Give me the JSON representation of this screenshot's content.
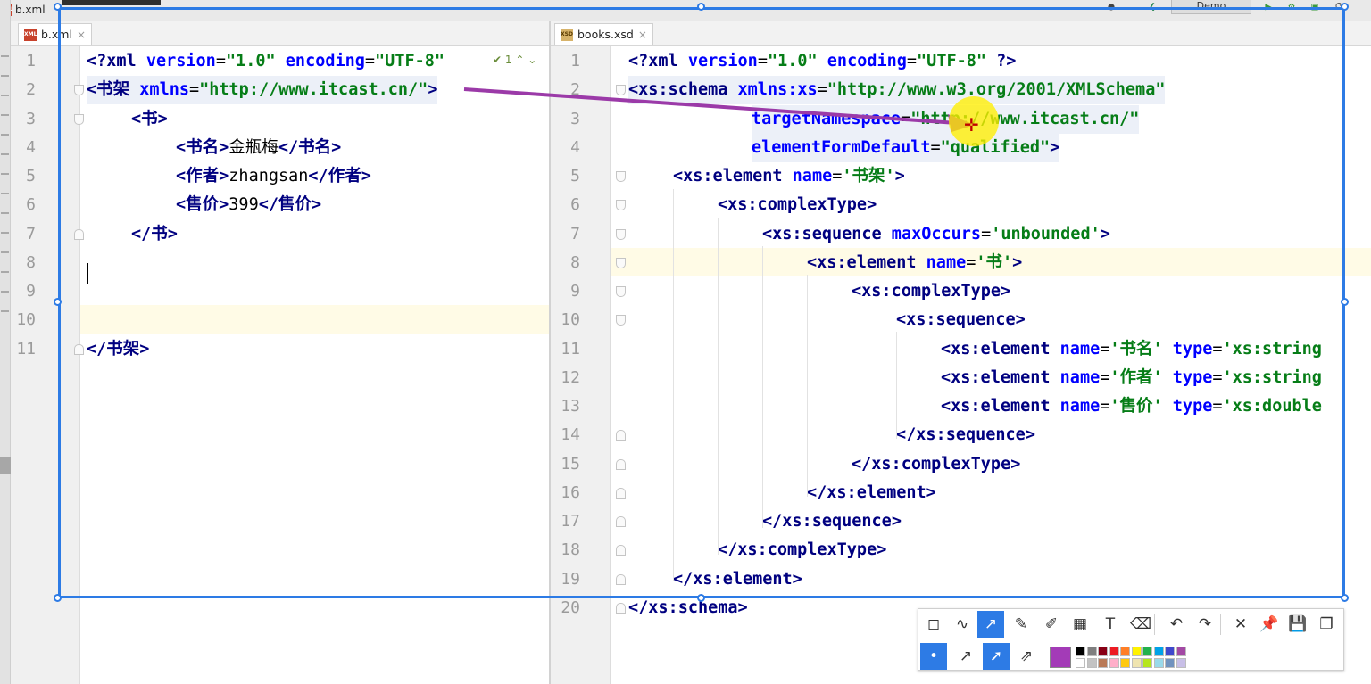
{
  "window": {
    "title_file": "b.xml",
    "run_config": "Demo"
  },
  "tabs": {
    "left": {
      "label": "b.xml",
      "close": "×"
    },
    "right": {
      "label": "books.xsd",
      "close": "×"
    }
  },
  "left_editor": {
    "hint": "✔ 1  ⌃  ⌄",
    "line_numbers": [
      "1",
      "2",
      "3",
      "4",
      "5",
      "6",
      "7",
      "8",
      "9",
      "10",
      "11"
    ],
    "lines": [
      [
        "<?",
        "xml",
        " version",
        "=",
        "\"1.0\"",
        " encoding",
        "=",
        "\"UTF-8\""
      ],
      [
        "<",
        "书架",
        " xmlns",
        "=",
        "\"http://www.itcast.cn/\"",
        ">"
      ],
      [
        "<",
        "书",
        ">"
      ],
      [
        "<",
        "书名",
        ">",
        "金瓶梅",
        "</",
        "书名",
        ">"
      ],
      [
        "<",
        "作者",
        ">",
        "zhangsan",
        "</",
        "作者",
        ">"
      ],
      [
        "<",
        "售价",
        ">",
        "399",
        "</",
        "售价",
        ">"
      ],
      [
        "</",
        "书",
        ">"
      ],
      [],
      [],
      [],
      [
        "</",
        "书架",
        ">"
      ]
    ]
  },
  "right_editor": {
    "line_numbers": [
      "1",
      "2",
      "3",
      "4",
      "5",
      "6",
      "7",
      "8",
      "9",
      "10",
      "11",
      "12",
      "13",
      "14",
      "15",
      "16",
      "17",
      "18",
      "19",
      "20"
    ],
    "lines": [
      [
        "<?",
        "xml",
        " version",
        "=",
        "\"1.0\"",
        " encoding",
        "=",
        "\"UTF-8\"",
        " ?>"
      ],
      [
        "<",
        "xs:schema",
        " xmlns:xs",
        "=",
        "\"http://www.w3.org/2001/XMLSchema\""
      ],
      [
        "targetNamespace",
        "=",
        "\"http://www.itcast.cn/\""
      ],
      [
        "elementFormDefault",
        "=",
        "\"qualified\"",
        ">"
      ],
      [
        "<",
        "xs:element",
        " name",
        "=",
        "'书架'",
        ">"
      ],
      [
        "<",
        "xs:complexType",
        ">"
      ],
      [
        "<",
        "xs:sequence",
        " maxOccurs",
        "=",
        "'unbounded'",
        ">"
      ],
      [
        "<",
        "xs:element",
        " name",
        "=",
        "'书'",
        ">"
      ],
      [
        "<",
        "xs:complexType",
        ">"
      ],
      [
        "<",
        "xs:sequence",
        ">"
      ],
      [
        "<",
        "xs:element",
        " name",
        "=",
        "'书名'",
        " type",
        "=",
        "'xs:string"
      ],
      [
        "<",
        "xs:element",
        " name",
        "=",
        "'作者'",
        " type",
        "=",
        "'xs:string"
      ],
      [
        "<",
        "xs:element",
        " name",
        "=",
        "'售价'",
        " type",
        "=",
        "'xs:double"
      ],
      [
        "</",
        "xs:sequence",
        ">"
      ],
      [
        "</",
        "xs:complexType",
        ">"
      ],
      [
        "</",
        "xs:element",
        ">"
      ],
      [
        "</",
        "xs:sequence",
        ">"
      ],
      [
        "</",
        "xs:complexType",
        ">"
      ],
      [
        "</",
        "xs:element",
        ">"
      ],
      [
        "</",
        "xs:schema",
        ">"
      ]
    ]
  },
  "draw_toolbar": {
    "row1": [
      "shape-tool-icon",
      "freehand-icon",
      "arrow-icon",
      "pen-icon",
      "marker-icon",
      "mosaic-icon",
      "text-icon",
      "eraser-icon",
      "undo-icon",
      "redo-icon",
      "close-icon",
      "pin-icon",
      "save-icon",
      "copy-icon"
    ],
    "row2": [
      "dot-size-icon",
      "line-arrow-icon",
      "filled-arrow-icon",
      "outline-arrow-icon"
    ],
    "selected_color": "#a33bb7",
    "palette_top": [
      "#000000",
      "#7f7f7f",
      "#880015",
      "#ed1c24",
      "#ff7f27",
      "#fff200",
      "#22b14c",
      "#00a2e8",
      "#3f48cc",
      "#a349a4"
    ],
    "palette_bottom": [
      "#ffffff",
      "#c3c3c3",
      "#b97a57",
      "#ffaec9",
      "#ffc90e",
      "#efe4b0",
      "#b5e61d",
      "#99d9ea",
      "#7092be",
      "#c8bfe7"
    ]
  },
  "colors": {
    "accent": "#2d7be5",
    "annotation_arrow": "#9b3aa8",
    "tag": "#000080",
    "attr": "#0000ff",
    "value": "#067d17"
  }
}
